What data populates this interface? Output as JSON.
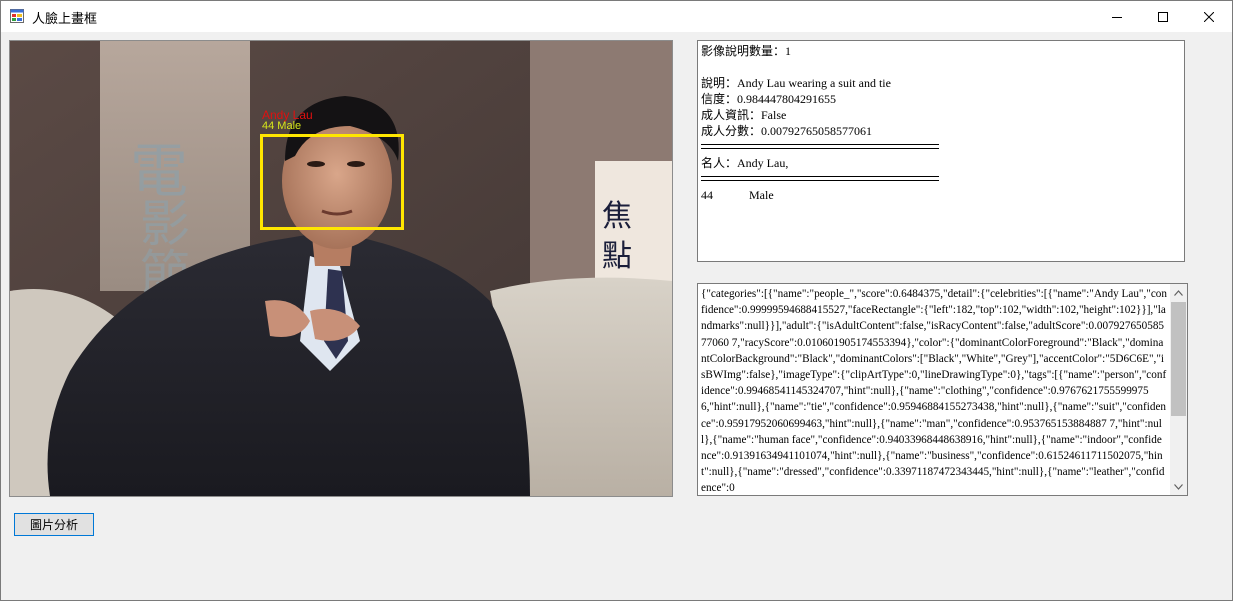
{
  "window": {
    "title": "人臉上畫框"
  },
  "picture": {
    "face_label_name": "Andy Lau",
    "face_label_info": "44 Male",
    "box_color": "#ffe600",
    "name_color": "#e01010",
    "info_color": "#d6e61a"
  },
  "result": {
    "caption_count": "影像說明數量：1",
    "caption": "說明：Andy Lau wearing a suit and tie",
    "confidence": "信度：0.984447804291655",
    "adult_info": "成人資訊：False",
    "adult_score": "成人分數：0.00792765058577061",
    "celebrity": "名人：Andy Lau,",
    "age": "44",
    "gender": "Male"
  },
  "json_output": {
    "text": "{\"categories\":[{\"name\":\"people_\",\"score\":0.6484375,\"detail\":{\"celebrities\":[{\"name\":\"Andy Lau\",\"confidence\":0.99999594688415527,\"faceRectangle\":{\"left\":182,\"top\":102,\"width\":102,\"height\":102}}],\"landmarks\":null}}],\"adult\":{\"isAdultContent\":false,\"isRacyContent\":false,\"adultScore\":0.00792765058577060 7,\"racyScore\":0.010601905174553394},\"color\":{\"dominantColorForeground\":\"Black\",\"dominantColorBackground\":\"Black\",\"dominantColors\":[\"Black\",\"White\",\"Grey\"],\"accentColor\":\"5D6C6E\",\"isBWImg\":false},\"imageType\":{\"clipArtType\":0,\"lineDrawingType\":0},\"tags\":[{\"name\":\"person\",\"confidence\":0.99468541145324707,\"hint\":null},{\"name\":\"clothing\",\"confidence\":0.97676217555999756,\"hint\":null},{\"name\":\"tie\",\"confidence\":0.95946884155273438,\"hint\":null},{\"name\":\"suit\",\"confidence\":0.95917952060699463,\"hint\":null},{\"name\":\"man\",\"confidence\":0.953765153884887 7,\"hint\":null},{\"name\":\"human face\",\"confidence\":0.94033968448638916,\"hint\":null},{\"name\":\"indoor\",\"confidence\":0.91391634941101074,\"hint\":null},{\"name\":\"business\",\"confidence\":0.61524611711502075,\"hint\":null},{\"name\":\"dressed\",\"confidence\":0.33971187472343445,\"hint\":null},{\"name\":\"leather\",\"confidence\":0"
  },
  "analyze_button": {
    "label": "圖片分析"
  }
}
